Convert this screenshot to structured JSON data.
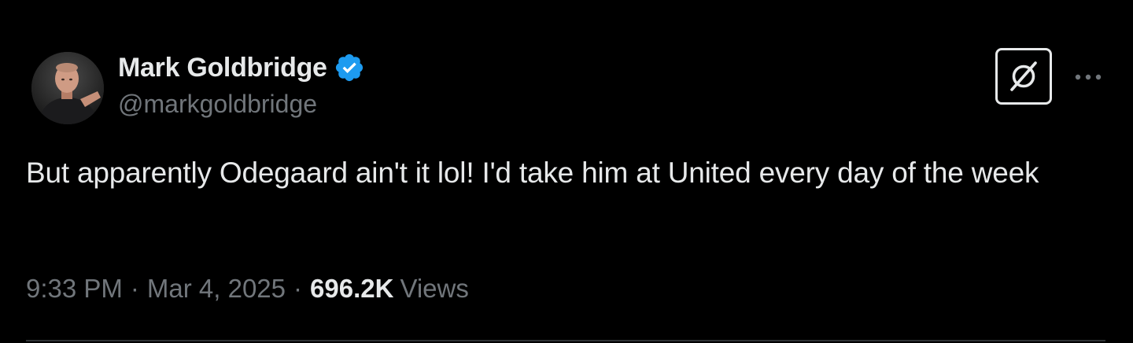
{
  "tweet": {
    "author": {
      "display_name": "Mark Goldbridge",
      "handle": "@markgoldbridge",
      "verified": true,
      "verified_color": "#1d9bf0",
      "avatar_icon": "user-avatar-photo"
    },
    "text": "But apparently Odegaard ain't it lol! I'd take him at United every day of the week",
    "meta": {
      "time": "9:33 PM",
      "separator": "·",
      "date": "Mar 4, 2025",
      "views_count": "696.2K",
      "views_label": "Views"
    },
    "actions": {
      "grok_icon": "grok-icon",
      "more_icon": "more-options-icon"
    }
  },
  "colors": {
    "background": "#000000",
    "primary_text": "#e7e9ea",
    "secondary_text": "#71767b",
    "divider": "#2f3336"
  }
}
